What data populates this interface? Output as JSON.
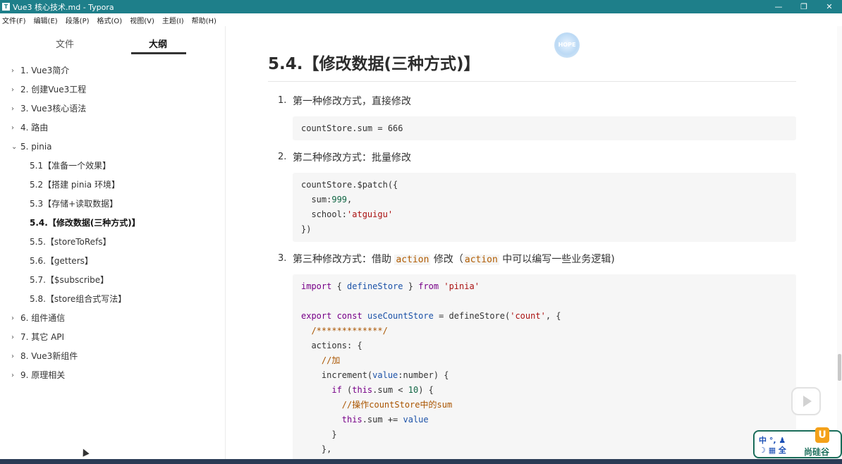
{
  "window": {
    "title": "Vue3 核心技术.md - Typora",
    "app_icon": "T",
    "controls": [
      "—",
      "❐",
      "✕"
    ]
  },
  "menu": [
    "文件(F)",
    "编辑(E)",
    "段落(P)",
    "格式(O)",
    "视图(V)",
    "主题(I)",
    "帮助(H)"
  ],
  "sidebar": {
    "tabs": {
      "files": "文件",
      "outline": "大纲"
    },
    "items": [
      {
        "label": "1. Vue3简介",
        "chevron": "›"
      },
      {
        "label": "2. 创建Vue3工程",
        "chevron": "›"
      },
      {
        "label": "3. Vue3核心语法",
        "chevron": "›"
      },
      {
        "label": "4. 路由",
        "chevron": "›"
      },
      {
        "label": "5. pinia",
        "chevron": "⌄"
      },
      {
        "label": "5.1【准备一个效果】"
      },
      {
        "label": "5.2【搭建 pinia 环境】"
      },
      {
        "label": "5.3【存储+读取数据】"
      },
      {
        "label": "5.4.【修改数据(三种方式)】"
      },
      {
        "label": "5.5.【storeToRefs】"
      },
      {
        "label": "5.6.【getters】"
      },
      {
        "label": "5.7.【$subscribe】"
      },
      {
        "label": "5.8.【store组合式写法】"
      },
      {
        "label": "6. 组件通信",
        "chevron": "›"
      },
      {
        "label": "7. 其它 API",
        "chevron": "›"
      },
      {
        "label": "8. Vue3新组件",
        "chevron": "›"
      },
      {
        "label": "9. 原理相关",
        "chevron": "›"
      }
    ]
  },
  "doc": {
    "heading": "5.4.【修改数据(三种方式)】",
    "list": [
      {
        "num": "1.",
        "text": "第一种修改方式，直接修改"
      },
      {
        "num": "2.",
        "text": "第二种修改方式：批量修改"
      },
      {
        "num": "3.",
        "text_a": "第三种修改方式：借助 ",
        "code_a": "action",
        "text_b": " 修改（",
        "code_b": "action",
        "text_c": " 中可以编写一些业务逻辑)"
      }
    ],
    "code1": [
      "countStore.sum = 666"
    ],
    "code2": {
      "l1": "countStore.$patch({",
      "l2a": "  sum:",
      "l2b": "999",
      "l2c": ",",
      "l3a": "  school:",
      "l3b": "'atguigu'",
      "l4": "})"
    },
    "code3": {
      "l1a": "import",
      "l1b": " { ",
      "l1c": "defineStore",
      "l1d": " } ",
      "l1e": "from",
      "l1f": " 'pinia'",
      "l3a": "export",
      "l3b": " const ",
      "l3c": "useCountStore",
      "l3d": " = defineStore(",
      "l3e": "'count'",
      "l3f": ", {",
      "l4": "  /*************/",
      "l5": "  actions: {",
      "l6": "    //加",
      "l7a": "    increment(",
      "l7b": "value",
      "l7c": ":number) {",
      "l8a": "      if",
      "l8b": " (",
      "l8c": "this",
      "l8d": ".sum < ",
      "l8e": "10",
      "l8f": ") {",
      "l9": "        //操作countStore中的sum",
      "l10a": "        this",
      "l10b": ".sum += ",
      "l10c": "value",
      "l11": "      }",
      "l12": "    },"
    }
  },
  "overlay": {
    "watermark": "HOPE",
    "brand_ime_line1": "中 °, ♟",
    "brand_ime_line2": "☽ ▦ 全",
    "brand_logo": "U",
    "brand_name": "尚硅谷"
  },
  "colors": {
    "titlebar": "#1e7f8a",
    "accent": "#b15c00"
  }
}
